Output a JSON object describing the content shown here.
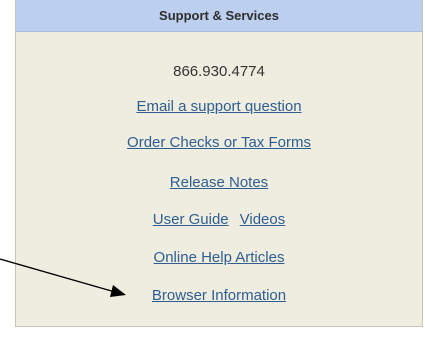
{
  "header": {
    "title": "Support & Services"
  },
  "phone": "866.930.4774",
  "links": {
    "email": "Email a support question",
    "order": "Order Checks or Tax Forms",
    "release_notes": "Release Notes",
    "user_guide": "User Guide",
    "videos": "Videos",
    "help_articles": "Online Help Articles",
    "browser_info": "Browser Information"
  },
  "colors": {
    "header_bg": "#bccfee",
    "panel_bg": "#efeddf",
    "link": "#2f5e92"
  }
}
